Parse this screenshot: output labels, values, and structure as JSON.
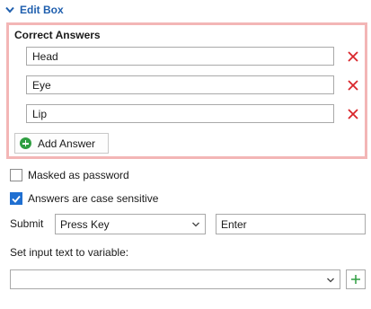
{
  "section": {
    "title": "Edit Box",
    "icon": "chevron-down-icon"
  },
  "answers": {
    "title": "Correct Answers",
    "items": [
      {
        "value": "Head"
      },
      {
        "value": "Eye"
      },
      {
        "value": "Lip"
      }
    ],
    "delete_icon": "close-icon",
    "delete_color": "#d9262b",
    "add_label": "Add Answer",
    "add_icon": "plus-circle-icon",
    "highlight_color": "#f3b6b6"
  },
  "options": {
    "masked": {
      "label": "Masked as password",
      "checked": false
    },
    "case_sensitive": {
      "label": "Answers are case sensitive",
      "checked": true
    }
  },
  "submit": {
    "label": "Submit",
    "mode": "Press Key",
    "key": "Enter"
  },
  "variable": {
    "label": "Set input text to variable:",
    "value": ""
  },
  "accent": "#1f5fae"
}
